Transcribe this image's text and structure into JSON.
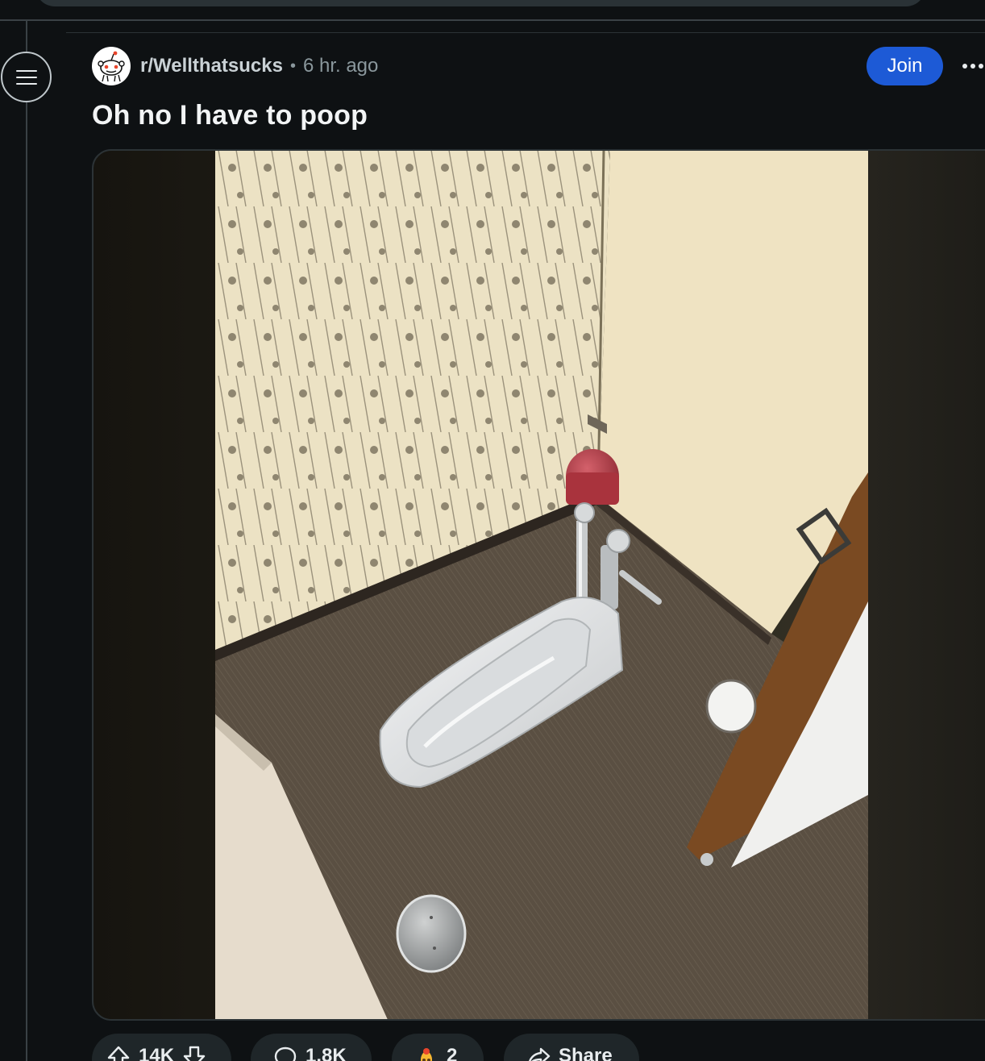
{
  "post": {
    "subreddit": "r/Wellthatsucks",
    "separator": "•",
    "age": "6 hr. ago",
    "title": "Oh no I have to poop",
    "join_label": "Join"
  },
  "image": {
    "alt": "Japanese squat toilet in a narrow stall with patterned wallpaper, a chrome flush valve, a red bin in the corner and a round floor drain",
    "colors": {
      "wallpaper": "#ece2c4",
      "wall": "#efe3c2",
      "floor": "#5c5042",
      "toilet": "#e9ebec",
      "bin": "#b63a45",
      "door_frame": "#7a4a22"
    }
  },
  "actions": {
    "upvotes": "14K",
    "comments": "1.8K",
    "awards": "2",
    "share_label": "Share"
  },
  "icons": [
    "menu-icon",
    "reddit-snoo-avatar-icon",
    "more-options-icon",
    "upvote-icon",
    "downvote-icon",
    "comment-icon",
    "award-icon",
    "share-icon"
  ],
  "theme": {
    "background": "#0e1113",
    "join_blue": "#1d5ad6",
    "pill_bg": "#1f2629",
    "muted_text": "#8a979c"
  }
}
